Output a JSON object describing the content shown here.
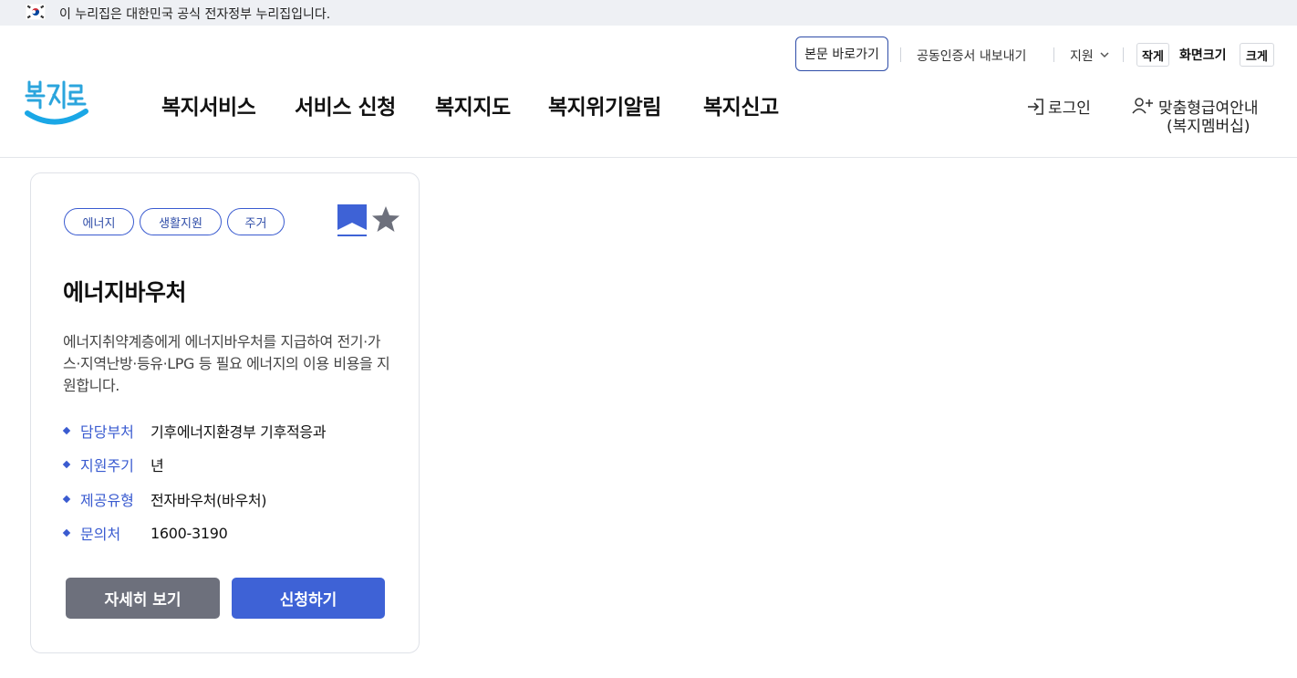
{
  "gov_banner": {
    "text": "이 누리집은 대한민국 공식 전자정부 누리집입니다."
  },
  "utility": {
    "skip_label": "본문 바로가기",
    "cert_label": "공동인증서 내보내기",
    "support_label": "지원",
    "small_label": "작게",
    "screen_size_label": "화면크기",
    "large_label": "크게"
  },
  "logo": {
    "text": "복지로"
  },
  "gnb": {
    "items": [
      "복지서비스",
      "서비스 신청",
      "복지지도",
      "복지위기알림",
      "복지신고"
    ]
  },
  "header_right": {
    "login_label": "로그인",
    "member_line1": "맞춤형급여안내",
    "member_line2": "(복지멤버십)"
  },
  "card": {
    "tags": [
      "에너지",
      "생활지원",
      "주거"
    ],
    "title": "에너지바우처",
    "description": "에너지취약계층에게 에너지바우처를 지급하여 전기·가스·지역난방·등유·LPG 등 필요 에너지의 이용 비용을 지원합니다.",
    "info": [
      {
        "label": "담당부처",
        "value": "기후에너지환경부 기후적응과"
      },
      {
        "label": "지원주기",
        "value": "년"
      },
      {
        "label": "제공유형",
        "value": "전자바우처(바우처)"
      },
      {
        "label": "문의처",
        "value": "1600-3190"
      }
    ],
    "detail_button": "자세히 보기",
    "apply_button": "신청하기"
  },
  "colors": {
    "accent": "#3e62d6",
    "tag_border": "#3a5bd0",
    "detail_button": "#6d707c",
    "banner_bg": "#eef0f4",
    "logo_blue": "#1aa7e6"
  },
  "icons": [
    "korea-flag-icon",
    "chevron-down-icon",
    "login-icon",
    "member-add-icon",
    "bookmark-icon",
    "star-icon"
  ]
}
